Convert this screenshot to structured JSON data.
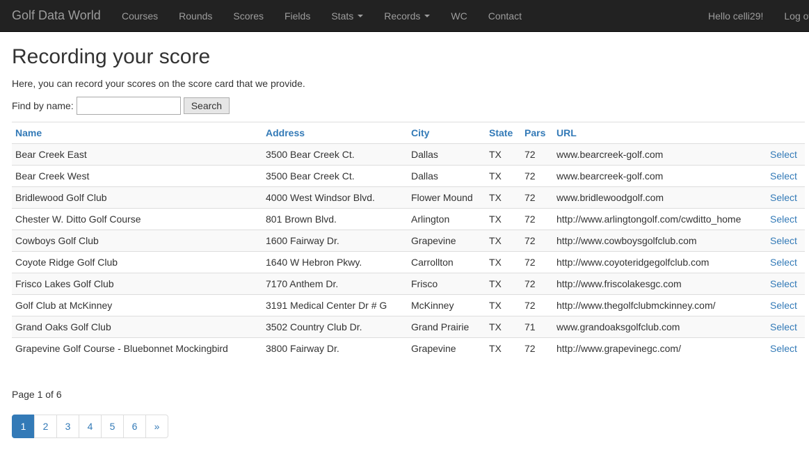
{
  "navbar": {
    "brand": "Golf Data World",
    "items": [
      {
        "label": "Courses",
        "dropdown": false
      },
      {
        "label": "Rounds",
        "dropdown": false
      },
      {
        "label": "Scores",
        "dropdown": false
      },
      {
        "label": "Fields",
        "dropdown": false
      },
      {
        "label": "Stats",
        "dropdown": true
      },
      {
        "label": "Records",
        "dropdown": true
      },
      {
        "label": "WC",
        "dropdown": false
      },
      {
        "label": "Contact",
        "dropdown": false
      }
    ],
    "greeting": "Hello celli29!",
    "logout": "Log off"
  },
  "page": {
    "title": "Recording your score",
    "intro": "Here, you can record your scores on the score card that we provide.",
    "find_label": "Find by name:",
    "search_value": "",
    "search_button": "Search"
  },
  "table": {
    "headers": [
      "Name",
      "Address",
      "City",
      "State",
      "Pars",
      "URL"
    ],
    "select_label": "Select",
    "rows": [
      {
        "name": "Bear Creek East",
        "address": "3500 Bear Creek Ct.",
        "city": "Dallas",
        "state": "TX",
        "pars": "72",
        "url": "www.bearcreek-golf.com"
      },
      {
        "name": "Bear Creek West",
        "address": "3500 Bear Creek Ct.",
        "city": "Dallas",
        "state": "TX",
        "pars": "72",
        "url": "www.bearcreek-golf.com"
      },
      {
        "name": "Bridlewood Golf Club",
        "address": "4000 West Windsor Blvd.",
        "city": "Flower Mound",
        "state": "TX",
        "pars": "72",
        "url": "www.bridlewoodgolf.com"
      },
      {
        "name": "Chester W. Ditto Golf Course",
        "address": "801 Brown Blvd.",
        "city": "Arlington",
        "state": "TX",
        "pars": "72",
        "url": "http://www.arlingtongolf.com/cwditto_home"
      },
      {
        "name": "Cowboys Golf Club",
        "address": "1600 Fairway Dr.",
        "city": "Grapevine",
        "state": "TX",
        "pars": "72",
        "url": "http://www.cowboysgolfclub.com"
      },
      {
        "name": "Coyote Ridge Golf Club",
        "address": "1640 W Hebron Pkwy.",
        "city": "Carrollton",
        "state": "TX",
        "pars": "72",
        "url": "http://www.coyoteridgegolfclub.com"
      },
      {
        "name": "Frisco Lakes Golf Club",
        "address": "7170 Anthem Dr.",
        "city": "Frisco",
        "state": "TX",
        "pars": "72",
        "url": "http://www.friscolakesgc.com"
      },
      {
        "name": "Golf Club at McKinney",
        "address": "3191 Medical Center Dr # G",
        "city": "McKinney",
        "state": "TX",
        "pars": "72",
        "url": "http://www.thegolfclubmckinney.com/"
      },
      {
        "name": "Grand Oaks Golf Club",
        "address": "3502 Country Club Dr.",
        "city": "Grand Prairie",
        "state": "TX",
        "pars": "71",
        "url": "www.grandoaksgolfclub.com"
      },
      {
        "name": "Grapevine Golf Course - Bluebonnet Mockingbird",
        "address": "3800 Fairway Dr.",
        "city": "Grapevine",
        "state": "TX",
        "pars": "72",
        "url": "http://www.grapevinegc.com/"
      }
    ]
  },
  "pagination": {
    "info": "Page 1 of 6",
    "pages": [
      "1",
      "2",
      "3",
      "4",
      "5",
      "6",
      "»"
    ],
    "active_index": 0
  },
  "colors": {
    "navbar_bg": "#222222",
    "link": "#337ab7",
    "stripe": "#f9f9f9"
  }
}
